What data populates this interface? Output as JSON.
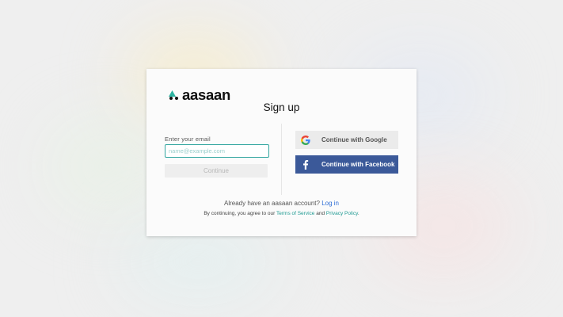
{
  "brand": {
    "name": "aasaan"
  },
  "signup": {
    "title": "Sign up",
    "email_label": "Enter your email",
    "email_placeholder": "name@example.com",
    "email_value": "",
    "continue_label": "Continue",
    "google_label": "Continue with Google",
    "facebook_label": "Continue with Facebook"
  },
  "footer": {
    "account_text": "Already have an aasaan account?",
    "login_link": "Log in",
    "terms_prefix": "By continuing, you agree to our",
    "terms_link": "Terms of Service",
    "and_text": "and",
    "privacy_link": "Privacy Policy",
    "period": "."
  },
  "colors": {
    "accent_teal": "#33a6a0",
    "facebook_blue": "#3b5999",
    "link_blue": "#2f6ed6"
  },
  "icons": {
    "logo": "aasaan-logo-icon",
    "google": "google-icon",
    "facebook": "facebook-icon"
  }
}
